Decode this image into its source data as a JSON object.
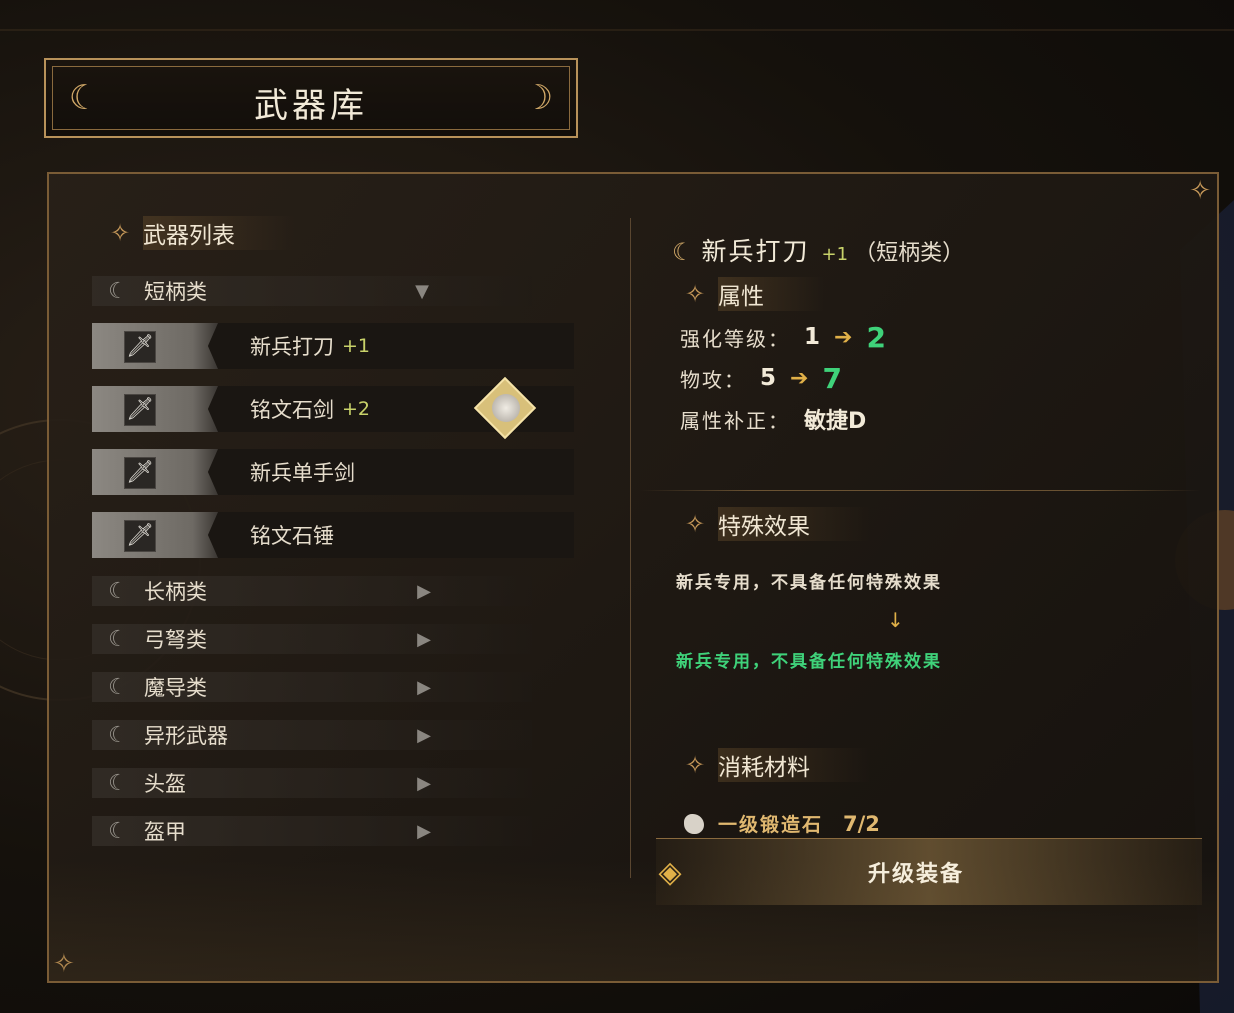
{
  "window": {
    "title": "武器库"
  },
  "left_panel": {
    "heading": "武器列表",
    "categories": [
      {
        "label": "短柄类",
        "state": "expanded"
      },
      {
        "label": "长柄类",
        "state": "collapsed"
      },
      {
        "label": "弓弩类",
        "state": "collapsed"
      },
      {
        "label": "魔导类",
        "state": "collapsed"
      },
      {
        "label": "异形武器",
        "state": "collapsed"
      },
      {
        "label": "头盔",
        "state": "collapsed"
      },
      {
        "label": "盔甲",
        "state": "collapsed"
      }
    ],
    "weapons": [
      {
        "name": "新兵打刀",
        "plus": "+1"
      },
      {
        "name": "铭文石剑",
        "plus": "+2",
        "equipped_by_character": true
      },
      {
        "name": "新兵单手剑",
        "plus": ""
      },
      {
        "name": "铭文石锤",
        "plus": ""
      }
    ]
  },
  "detail": {
    "name": "新兵打刀",
    "plus": "+1",
    "category": "（短柄类）",
    "attributes_heading": "属性",
    "stats": [
      {
        "key": "强化等级：",
        "from": "1",
        "to": "2"
      },
      {
        "key": "物攻：",
        "from": "5",
        "to": "7"
      },
      {
        "key": "属性补正：",
        "value": "敏捷D"
      }
    ],
    "effects_heading": "特殊效果",
    "effect_current": "新兵专用，不具备任何特殊效果",
    "effect_next": "新兵专用，不具备任何特殊效果",
    "materials_heading": "消耗材料",
    "material": {
      "name": "一级锻造石",
      "count": "7/2"
    },
    "upgrade_button": "升级装备"
  },
  "colors": {
    "accent_gold": "#c89a5a",
    "upgrade_green": "#3fd27a",
    "arrow_orange": "#e0b048",
    "plus_yellow": "#c9d36a"
  },
  "icons": {
    "category": "crescent-moon-icon",
    "expand": "triangle-down-icon",
    "collapse": "triangle-right-icon",
    "weapon": "sword-icon",
    "section": "four-point-star-icon"
  }
}
